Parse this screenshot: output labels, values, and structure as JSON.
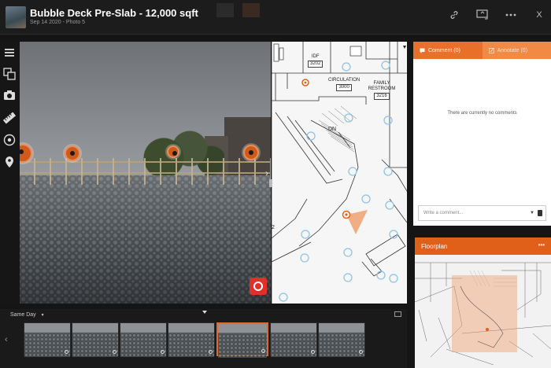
{
  "header": {
    "title": "Bubble Deck Pre-Slab - 12,000 sqft",
    "subtitle": "Sep 14 2020 - Photo 5",
    "icons": [
      "link-icon",
      "monitor-icon",
      "more-icon",
      "close-icon"
    ],
    "close_label": "X"
  },
  "toolbar": {
    "tools": [
      "menu-icon",
      "compare-icon",
      "camera-icon",
      "measure-icon",
      "record-icon",
      "location-pin-icon"
    ]
  },
  "plan": {
    "rooms": [
      {
        "name": "IDF",
        "number": "3202"
      },
      {
        "name": "CIRCULATION",
        "number": "3000"
      },
      {
        "name": "FAMILY RESTROOM",
        "number": "3216"
      }
    ],
    "dn_label": "DN",
    "grid_label": "2"
  },
  "comments_panel": {
    "tab_comment": "Comment (0)",
    "tab_annotate": "Annotate (0)",
    "empty_text": "There are currently no comments",
    "input_placeholder": "Write a comment..."
  },
  "floorplan_panel": {
    "title": "Floorplan",
    "menu": "•••"
  },
  "filmstrip": {
    "filter_label": "Same Day",
    "frame_count": 7,
    "selected_index": 4
  },
  "colors": {
    "accent": "#e8702a",
    "header_bg": "#1c1c1c"
  }
}
